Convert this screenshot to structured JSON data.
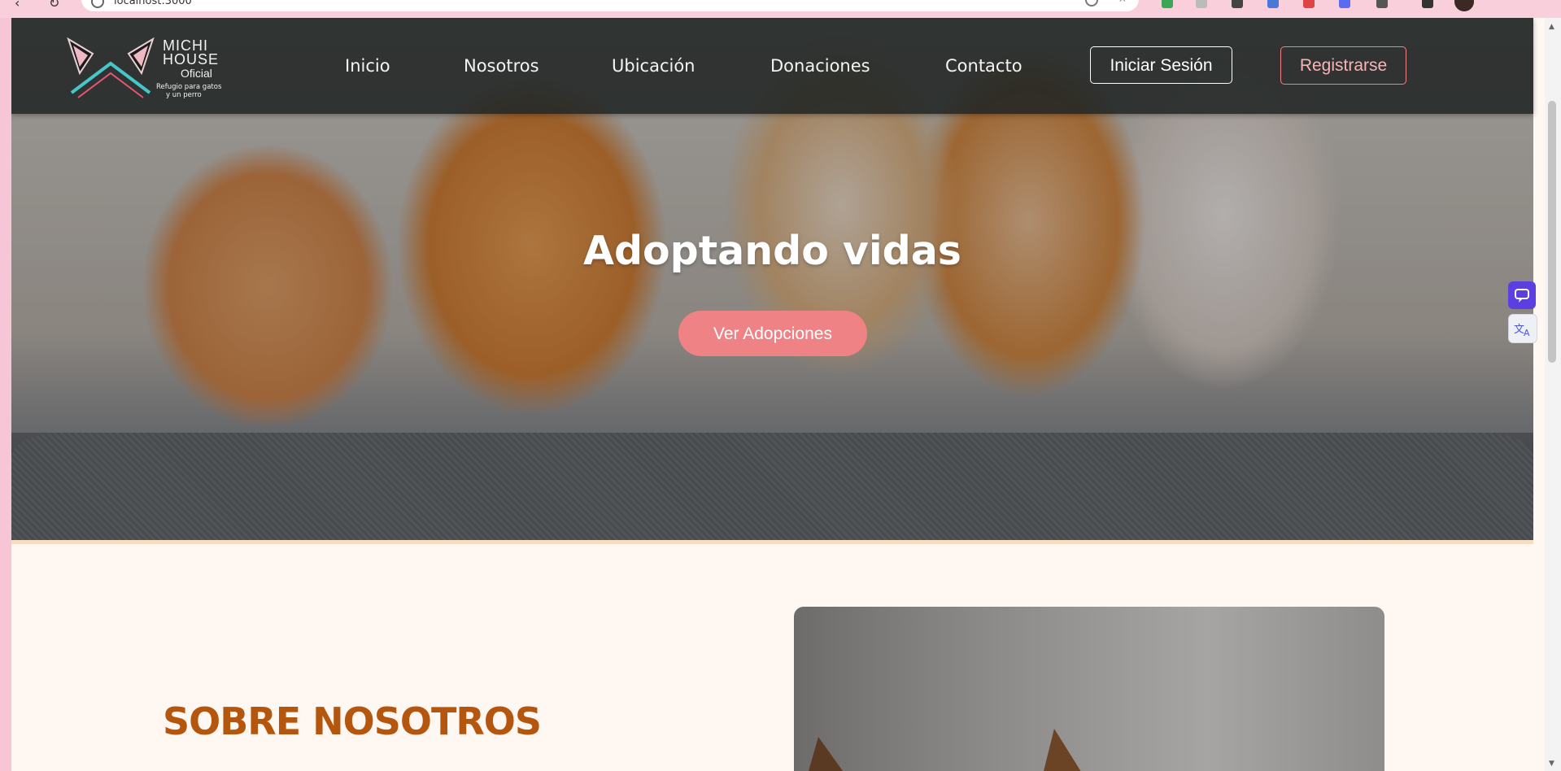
{
  "browser": {
    "url": "localhost:3000"
  },
  "header": {
    "logo": {
      "brand_line1": "MICHI",
      "brand_line2": "HOUSE",
      "brand_line3": "Oficial",
      "tagline_line1": "Refugio para gatos",
      "tagline_line2": "y un perro"
    },
    "nav": [
      {
        "label": "Inicio"
      },
      {
        "label": "Nosotros"
      },
      {
        "label": "Ubicación"
      },
      {
        "label": "Donaciones"
      },
      {
        "label": "Contacto"
      }
    ],
    "login_label": "Iniciar Sesión",
    "register_label": "Registrarse"
  },
  "hero": {
    "title": "Adoptando vidas",
    "cta_label": "Ver Adopciones"
  },
  "about": {
    "title": "SOBRE NOSOTROS"
  },
  "side_widgets": {
    "icons": [
      "chat-icon",
      "translate-icon"
    ]
  },
  "colors": {
    "accent": "#ee8285",
    "about_title": "#b5560f",
    "navbar_bg": "#212524",
    "section_bg": "#fff7f2"
  }
}
